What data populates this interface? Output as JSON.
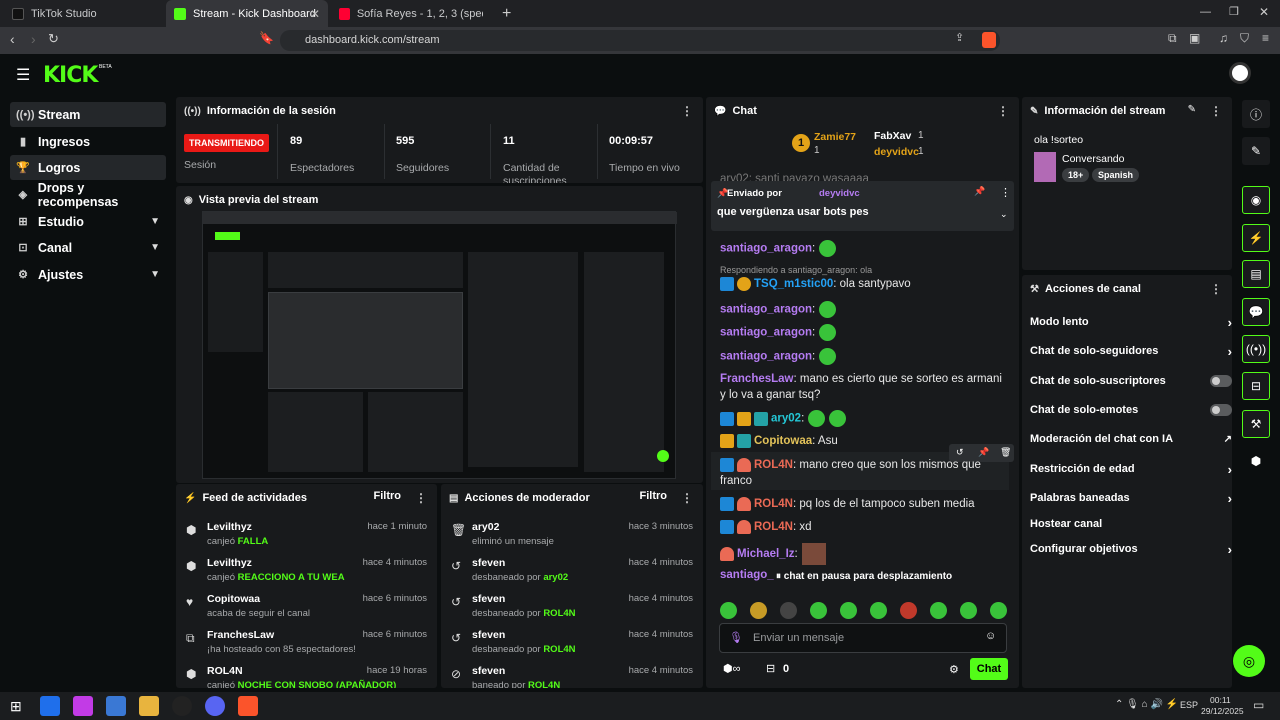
{
  "browser": {
    "tabs": [
      {
        "label": "TikTok Studio"
      },
      {
        "label": "Stream - Kick Dashboard"
      },
      {
        "label": "Sofía Reyes - 1, 2, 3 (sped up) Ly..."
      }
    ],
    "url": "dashboard.kick.com/stream"
  },
  "app": {
    "logo": "KICK",
    "beta": "BETA"
  },
  "sidebar": {
    "items": [
      {
        "label": "Stream",
        "icon": "broadcast-icon"
      },
      {
        "label": "Ingresos",
        "icon": "bars-icon"
      },
      {
        "label": "Logros",
        "icon": "trophy-icon"
      },
      {
        "label": "Drops y recompensas",
        "icon": "gift-icon"
      },
      {
        "label": "Estudio",
        "icon": "studio-icon"
      },
      {
        "label": "Canal",
        "icon": "channel-icon"
      },
      {
        "label": "Ajustes",
        "icon": "gear-icon"
      }
    ]
  },
  "session": {
    "title": "Información de la sesión",
    "live_badge": "TRANSMITIENDO",
    "stats": [
      {
        "value": "",
        "label": "Sesión"
      },
      {
        "value": "89",
        "label": "Espectadores"
      },
      {
        "value": "595",
        "label": "Seguidores"
      },
      {
        "value": "11",
        "label": "Cantidad de suscripciones"
      },
      {
        "value": "00:09:57",
        "label": "Tiempo en vivo"
      }
    ]
  },
  "preview": {
    "title": "Vista previa del stream"
  },
  "activity": {
    "title": "Feed de actividades",
    "filter": "Filtro",
    "rows": [
      {
        "name": "Levilthyz",
        "time": "hace 1 minuto",
        "desc": "canjeó",
        "hl": "FALLA",
        "icon": "gift-icon"
      },
      {
        "name": "Levilthyz",
        "time": "hace 4 minutos",
        "desc": "canjeó",
        "hl": "REACCIONO A TU WEA",
        "icon": "gift-icon"
      },
      {
        "name": "Copitowaa",
        "time": "hace 6 minutos",
        "desc": "acaba de seguir el canal",
        "hl": "",
        "icon": "heart-icon"
      },
      {
        "name": "FranchesLaw",
        "time": "hace 6 minutos",
        "desc": "¡ha hosteado con 85 espectadores!",
        "hl": "",
        "icon": "host-icon"
      },
      {
        "name": "ROL4N",
        "time": "hace 19 horas",
        "desc": "canjeó",
        "hl": "NOCHE CON SNOBO (APAÑADOR)",
        "icon": "gift-icon"
      }
    ]
  },
  "modactions": {
    "title": "Acciones de moderador",
    "filter": "Filtro",
    "rows": [
      {
        "name": "ary02",
        "time": "hace 3 minutos",
        "desc": "eliminó un mensaje",
        "by": "",
        "icon": "trash-icon"
      },
      {
        "name": "sfeven",
        "time": "hace 4 minutos",
        "desc": "desbaneado por",
        "by": "ary02",
        "icon": "undo-icon"
      },
      {
        "name": "sfeven",
        "time": "hace 4 minutos",
        "desc": "desbaneado por",
        "by": "ROL4N",
        "icon": "undo-icon"
      },
      {
        "name": "sfeven",
        "time": "hace 4 minutos",
        "desc": "desbaneado por",
        "by": "ROL4N",
        "icon": "undo-icon"
      },
      {
        "name": "sfeven",
        "time": "hace 4 minutos",
        "desc": "baneado por",
        "by": "ROL4N",
        "icon": "ban-icon"
      }
    ]
  },
  "chat": {
    "title": "Chat",
    "top": [
      {
        "name": "Zamie77",
        "count": "1"
      },
      {
        "name": "FabXav",
        "count": "1"
      },
      {
        "name": "deyvidvc",
        "count": "1"
      }
    ],
    "partial_line": "ary02: santi payazo wasaaaa",
    "pinned": {
      "by_label": "Enviado por",
      "by_user": "deyvidvc",
      "text": "que vergüenza usar bots pes"
    },
    "reply_hint": "Respondiendo a santiago_aragon: ola",
    "messages": [
      {
        "user": "santiago_aragon",
        "sep": ":",
        "text": ""
      },
      {
        "user": "TSQ_m1stic00",
        "sep": ":",
        "text": " ola santypavo"
      },
      {
        "user": "santiago_aragon",
        "sep": ":",
        "text": ""
      },
      {
        "user": "santiago_aragon",
        "sep": ":",
        "text": ""
      },
      {
        "user": "santiago_aragon",
        "sep": ":",
        "text": ""
      },
      {
        "user": "FranchesLaw",
        "sep": ":",
        "text": " mano es cierto que se sorteo es armani y lo va a ganar tsq?"
      },
      {
        "user": "ary02",
        "sep": ":",
        "text": ""
      },
      {
        "user": "Copitowaa",
        "sep": ":",
        "text": " Asu"
      },
      {
        "user": "ROL4N",
        "sep": ":",
        "text": " mano creo que son los mismos que franco"
      },
      {
        "user": "ROL4N",
        "sep": ":",
        "text": " pq los de el tampoco suben media"
      },
      {
        "user": "ROL4N",
        "sep": ":",
        "text": " xd"
      },
      {
        "user": "Michael_Iz",
        "sep": ":",
        "text": ""
      },
      {
        "user": "santiago_",
        "sep": "",
        "text": ""
      }
    ],
    "paused": "chat en pausa para desplazamiento",
    "input_placeholder": "Enviar un mensaje",
    "points": "0",
    "send": "Chat"
  },
  "streaminfo": {
    "title": "Información del stream",
    "stream_title": "ola !sorteo",
    "category": "Conversando",
    "tags": [
      "18+",
      "Spanish"
    ]
  },
  "channel": {
    "title": "Acciones de canal",
    "items": [
      {
        "label": "Modo lento",
        "ctrl": "arrow"
      },
      {
        "label": "Chat de solo-seguidores",
        "ctrl": "arrow"
      },
      {
        "label": "Chat de solo-suscriptores",
        "ctrl": "toggle"
      },
      {
        "label": "Chat de solo-emotes",
        "ctrl": "toggle"
      },
      {
        "label": "Moderación del chat con IA",
        "ctrl": "external"
      },
      {
        "label": "Restricción de edad",
        "ctrl": "arrow"
      },
      {
        "label": "Palabras baneadas",
        "ctrl": "arrow"
      },
      {
        "label": "Hostear canal",
        "ctrl": "none"
      },
      {
        "label": "Configurar objetivos",
        "ctrl": "arrow"
      }
    ]
  },
  "taskbar": {
    "lang": "ESP",
    "time": "00:11",
    "date": "29/12/2025"
  },
  "colors": {
    "accent": "#53fc18",
    "live": "#e91916",
    "panel": "#181a1c",
    "username": "#b57cf2"
  }
}
